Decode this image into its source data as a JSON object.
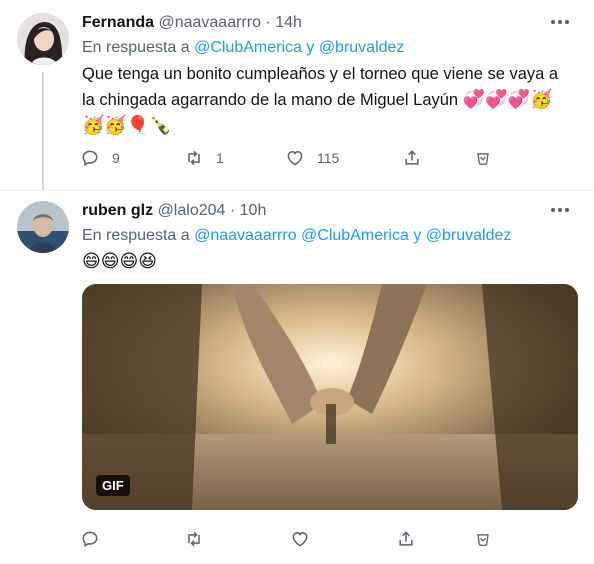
{
  "tweets": [
    {
      "name": "Fernanda",
      "handle": "@naavaaarrro",
      "dot": "·",
      "time": "14h",
      "reply_prefix": "En respuesta a",
      "reply_mention_1": "@ClubAmerica",
      "reply_and": "y",
      "reply_mention_2": "@bruvaldez",
      "text_line1": "Que tenga un bonito cumpleaños y el torneo que viene se vaya a",
      "text_line2": "la chingada agarrando de la mano de Miguel Layún",
      "emoji_line2": "💞💞💞🥳",
      "emoji_line3": "🥳🥳🎈🍾",
      "replies": "9",
      "retweets": "1",
      "likes": "115"
    },
    {
      "name": "ruben glz",
      "handle": "@lalo204",
      "dot": "·",
      "time": "10h",
      "reply_prefix": "En respuesta a",
      "reply_mention_1": "@naavaaarrro",
      "reply_mention_2": "@ClubAmerica",
      "reply_and": "y",
      "reply_mention_3": "@bruvaldez",
      "emoji_text": "😄😄😄😆",
      "gif_badge": "GIF"
    }
  ],
  "icons": {
    "more": "more-horizontal-icon",
    "reply": "reply-icon",
    "retweet": "retweet-icon",
    "like": "heart-icon",
    "share": "share-icon",
    "tip": "tip-jar-icon"
  },
  "colors": {
    "mention": "#1d9bf0",
    "secondary_text": "#536471",
    "primary_text": "#0f1419",
    "thread_line": "#cfd9de"
  }
}
